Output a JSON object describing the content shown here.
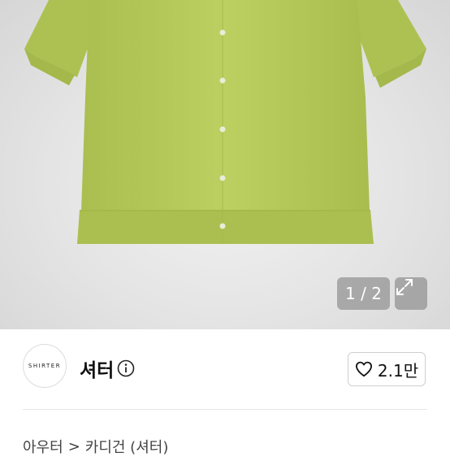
{
  "gallery": {
    "counter": "1 / 2",
    "expand_icon": "expand-arrows-icon",
    "shirt_color": "#b8cc5c"
  },
  "shop": {
    "logo_text": "SHIRTER",
    "name": "셔터",
    "info_icon": "info-circle-icon",
    "like_icon": "heart-outline-icon",
    "like_count": "2.1만"
  },
  "breadcrumb": {
    "category": "아우터",
    "separator": ">",
    "subcategory": "카디건 (셔터)"
  }
}
